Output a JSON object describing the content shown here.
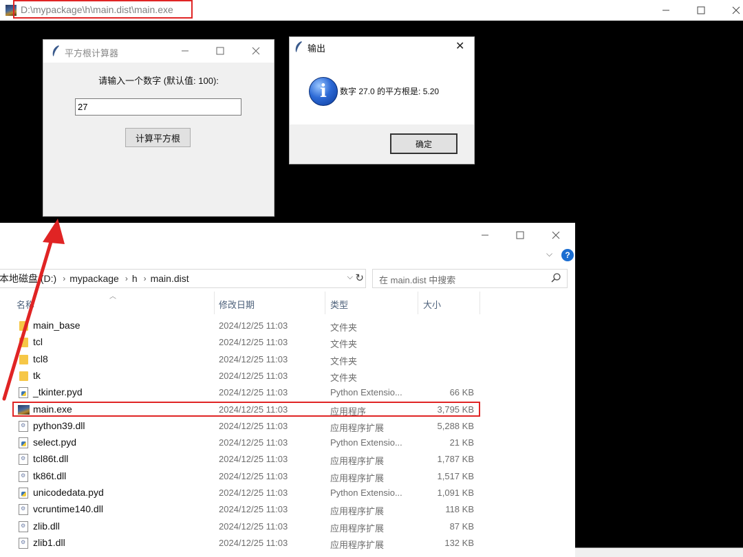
{
  "console": {
    "path": "D:\\mypackage\\h\\main.dist\\main.exe",
    "minimize_icon": "minimize-icon",
    "maximize_icon": "maximize-icon",
    "close_icon": "close-icon"
  },
  "tk_window": {
    "title": "平方根计算器",
    "prompt": "请输入一个数字 (默认值: 100):",
    "input_value": "27",
    "button_label": "计算平方根"
  },
  "dialog": {
    "title": "输出",
    "message": "数字 27.0 的平方根是: 5.20",
    "ok_label": "确定",
    "icon": "info-icon"
  },
  "explorer": {
    "breadcrumbs": [
      "本地磁盘 (D:)",
      "mypackage",
      "h",
      "main.dist"
    ],
    "search_placeholder": "在 main.dist 中搜索",
    "columns": [
      "名称",
      "修改日期",
      "类型",
      "大小"
    ],
    "files": [
      {
        "name": "main_base",
        "date": "2024/12/25 11:03",
        "type": "文件夹",
        "size": "",
        "icon": "folder"
      },
      {
        "name": "tcl",
        "date": "2024/12/25 11:03",
        "type": "文件夹",
        "size": "",
        "icon": "folder"
      },
      {
        "name": "tcl8",
        "date": "2024/12/25 11:03",
        "type": "文件夹",
        "size": "",
        "icon": "folder"
      },
      {
        "name": "tk",
        "date": "2024/12/25 11:03",
        "type": "文件夹",
        "size": "",
        "icon": "folder"
      },
      {
        "name": "_tkinter.pyd",
        "date": "2024/12/25 11:03",
        "type": "Python Extensio...",
        "size": "66 KB",
        "icon": "py"
      },
      {
        "name": "main.exe",
        "date": "2024/12/25 11:03",
        "type": "应用程序",
        "size": "3,795 KB",
        "icon": "exe"
      },
      {
        "name": "python39.dll",
        "date": "2024/12/25 11:03",
        "type": "应用程序扩展",
        "size": "5,288 KB",
        "icon": "dll"
      },
      {
        "name": "select.pyd",
        "date": "2024/12/25 11:03",
        "type": "Python Extensio...",
        "size": "21 KB",
        "icon": "py"
      },
      {
        "name": "tcl86t.dll",
        "date": "2024/12/25 11:03",
        "type": "应用程序扩展",
        "size": "1,787 KB",
        "icon": "dll"
      },
      {
        "name": "tk86t.dll",
        "date": "2024/12/25 11:03",
        "type": "应用程序扩展",
        "size": "1,517 KB",
        "icon": "dll"
      },
      {
        "name": "unicodedata.pyd",
        "date": "2024/12/25 11:03",
        "type": "Python Extensio...",
        "size": "1,091 KB",
        "icon": "py"
      },
      {
        "name": "vcruntime140.dll",
        "date": "2024/12/25 11:03",
        "type": "应用程序扩展",
        "size": "118 KB",
        "icon": "dll"
      },
      {
        "name": "zlib.dll",
        "date": "2024/12/25 11:03",
        "type": "应用程序扩展",
        "size": "87 KB",
        "icon": "dll"
      },
      {
        "name": "zlib1.dll",
        "date": "2024/12/25 11:03",
        "type": "应用程序扩展",
        "size": "132 KB",
        "icon": "dll"
      }
    ]
  },
  "annotation_color": "#e02424"
}
